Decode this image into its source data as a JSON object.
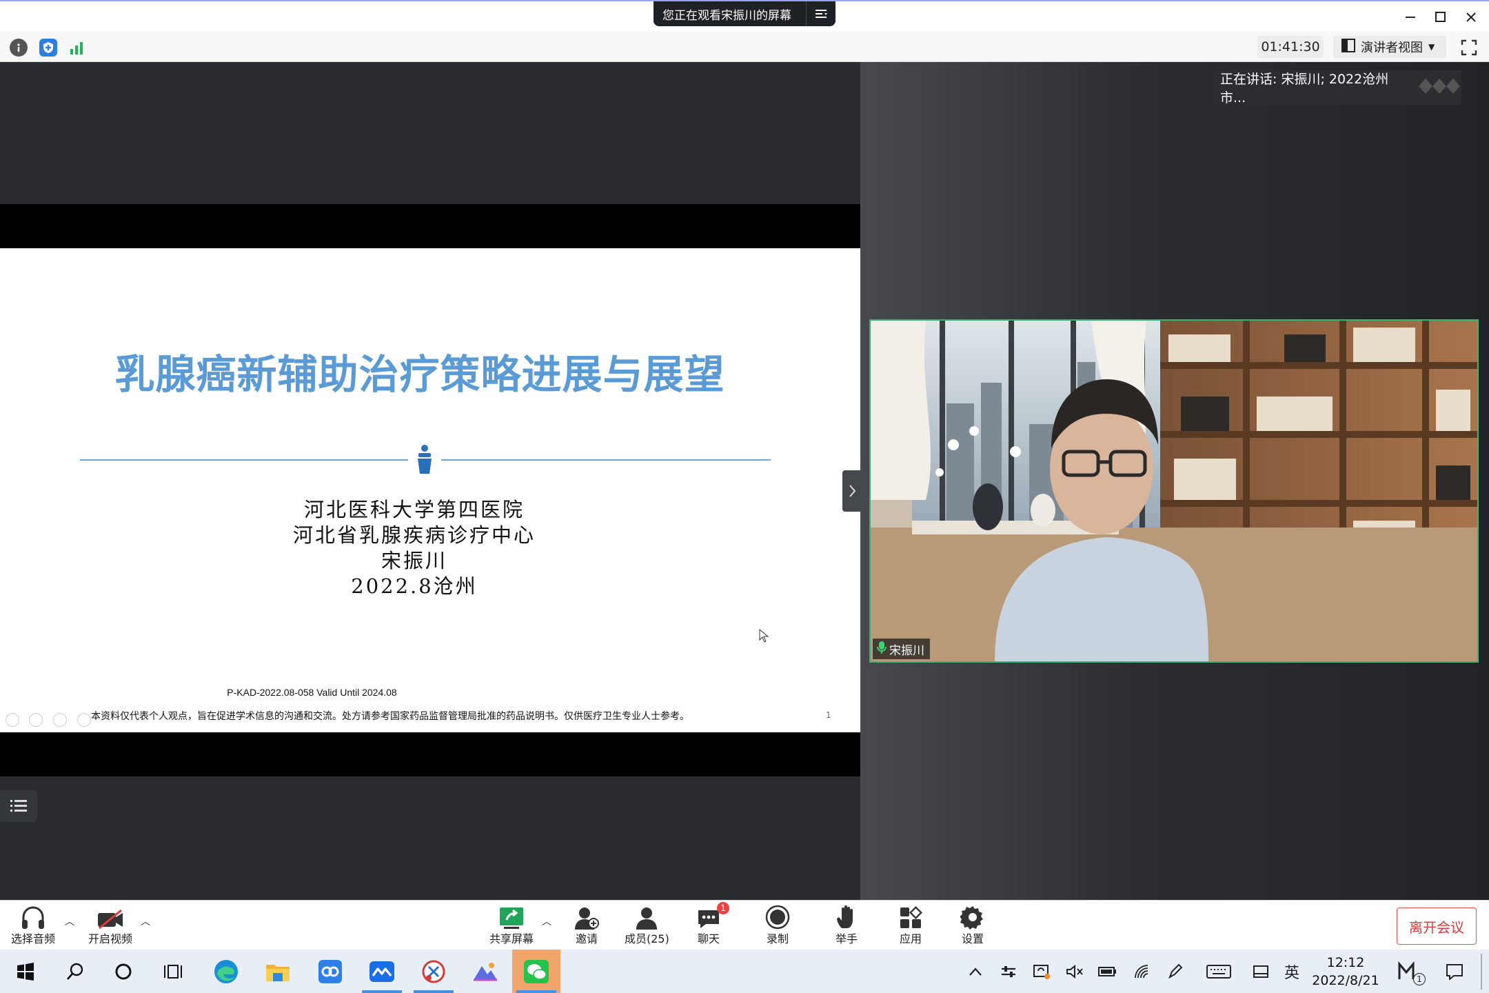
{
  "window": {
    "share_banner": "您正在观看宋振川的屏幕"
  },
  "infobar": {
    "timer": "01:41:30",
    "view_mode": "演讲者视图"
  },
  "slide": {
    "title": "乳腺癌新辅助治疗策略进展与展望",
    "line1": "河北医科大学第四医院",
    "line2": "河北省乳腺疾病诊疗中心",
    "line3": "宋振川",
    "line4": "2022.8沧州",
    "code": "P-KAD-2022.08-058 Valid Until 2024.08",
    "disclaimer": "本资料仅代表个人观点，旨在促进学术信息的沟通和交流。处方请参考国家药品监督管理局批准的药品说明书。仅供医疗卫生专业人士参考。",
    "page_number": "1"
  },
  "speaker_panel": {
    "speaking_label": "正在讲话: 宋振川; 2022沧州市...",
    "participant_name": "宋振川"
  },
  "toolbar": {
    "audio": "选择音频",
    "video": "开启视频",
    "share": "共享屏幕",
    "invite": "邀请",
    "members": "成员(25)",
    "chat": "聊天",
    "chat_badge": "1",
    "record": "录制",
    "raise_hand": "举手",
    "apps": "应用",
    "settings": "设置",
    "leave": "离开会议"
  },
  "taskbar": {
    "ime": "英",
    "time": "12:12",
    "date": "2022/8/21",
    "notification_count": "1"
  },
  "colors": {
    "accent_green": "#3bb273",
    "slide_title_blue": "#5b9bd5",
    "leave_red": "#e03b3b"
  }
}
